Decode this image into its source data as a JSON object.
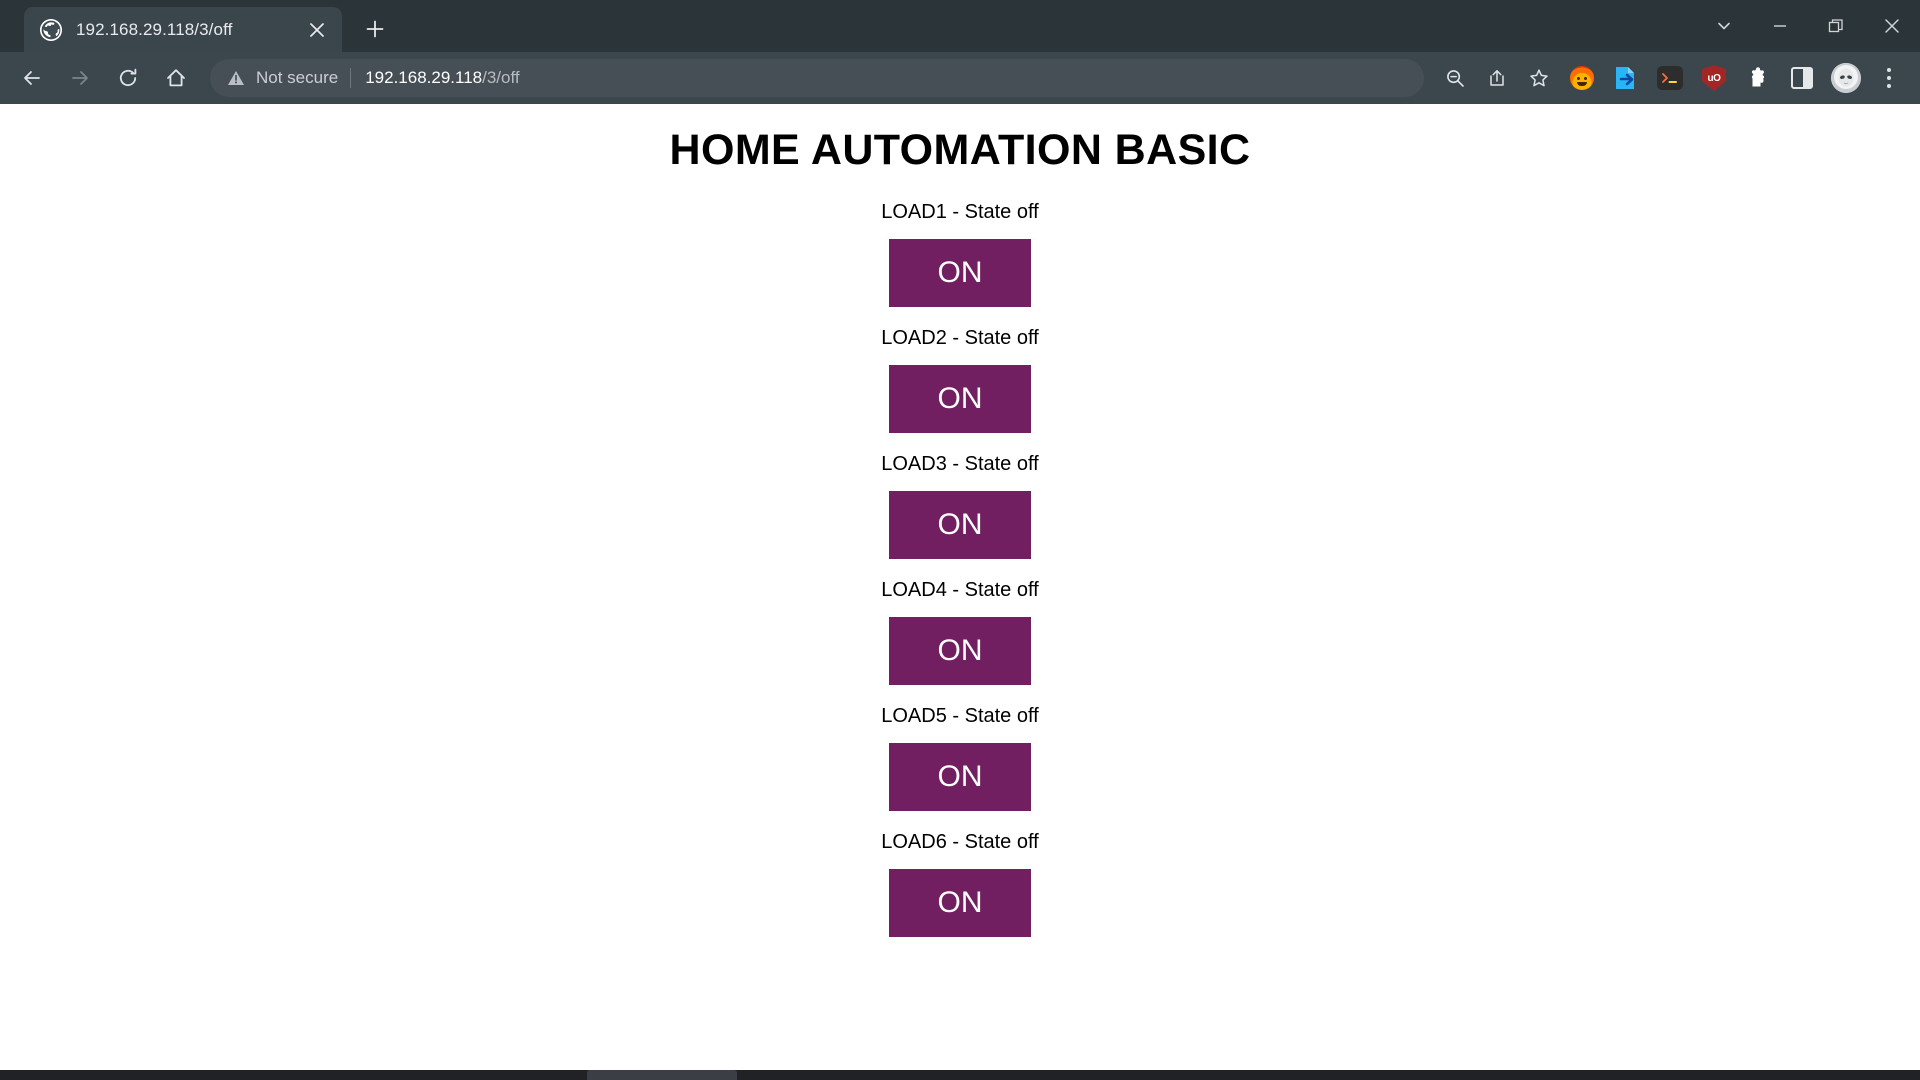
{
  "browser": {
    "tab": {
      "title": "192.168.29.118/3/off",
      "favicon_name": "globe-icon",
      "close_label": "×"
    },
    "new_tab_label": "+",
    "window_controls": {
      "tab_search_label": "⌄",
      "minimize_label": "—",
      "maximize_label": "❐",
      "close_label": "×"
    },
    "toolbar": {
      "back_label": "←",
      "forward_label": "→",
      "reload_label": "↻",
      "home_label": "⌂",
      "security_text": "Not secure",
      "url_host": "192.168.29.118",
      "url_path": "/3/off",
      "url_full": "192.168.29.118/3/off",
      "zoom_out_label": "zoom-out",
      "share_label": "share",
      "bookmark_label": "bookmark",
      "extensions": [
        {
          "name": "flame-extension-icon",
          "label": ""
        },
        {
          "name": "document-sync-extension-icon",
          "label": ""
        },
        {
          "name": "terminal-extension-icon",
          "label": ">_"
        },
        {
          "name": "ublock-origin-extension-icon",
          "label": "uO"
        },
        {
          "name": "extensions-puzzle-icon",
          "label": ""
        },
        {
          "name": "side-panel-icon",
          "label": ""
        }
      ],
      "profile_label": "profile-avatar",
      "menu_label": "⋮"
    }
  },
  "page": {
    "title": "HOME AUTOMATION BASIC",
    "button_color": "#711f60",
    "button_text_color": "#ffffff",
    "loads": [
      {
        "label": "LOAD1 - State off",
        "name": "LOAD1",
        "state": "off",
        "button": "ON"
      },
      {
        "label": "LOAD2 - State off",
        "name": "LOAD2",
        "state": "off",
        "button": "ON"
      },
      {
        "label": "LOAD3 - State off",
        "name": "LOAD3",
        "state": "off",
        "button": "ON"
      },
      {
        "label": "LOAD4 - State off",
        "name": "LOAD4",
        "state": "off",
        "button": "ON"
      },
      {
        "label": "LOAD5 - State off",
        "name": "LOAD5",
        "state": "off",
        "button": "ON"
      },
      {
        "label": "LOAD6 - State off",
        "name": "LOAD6",
        "state": "off",
        "button": "ON"
      }
    ]
  }
}
